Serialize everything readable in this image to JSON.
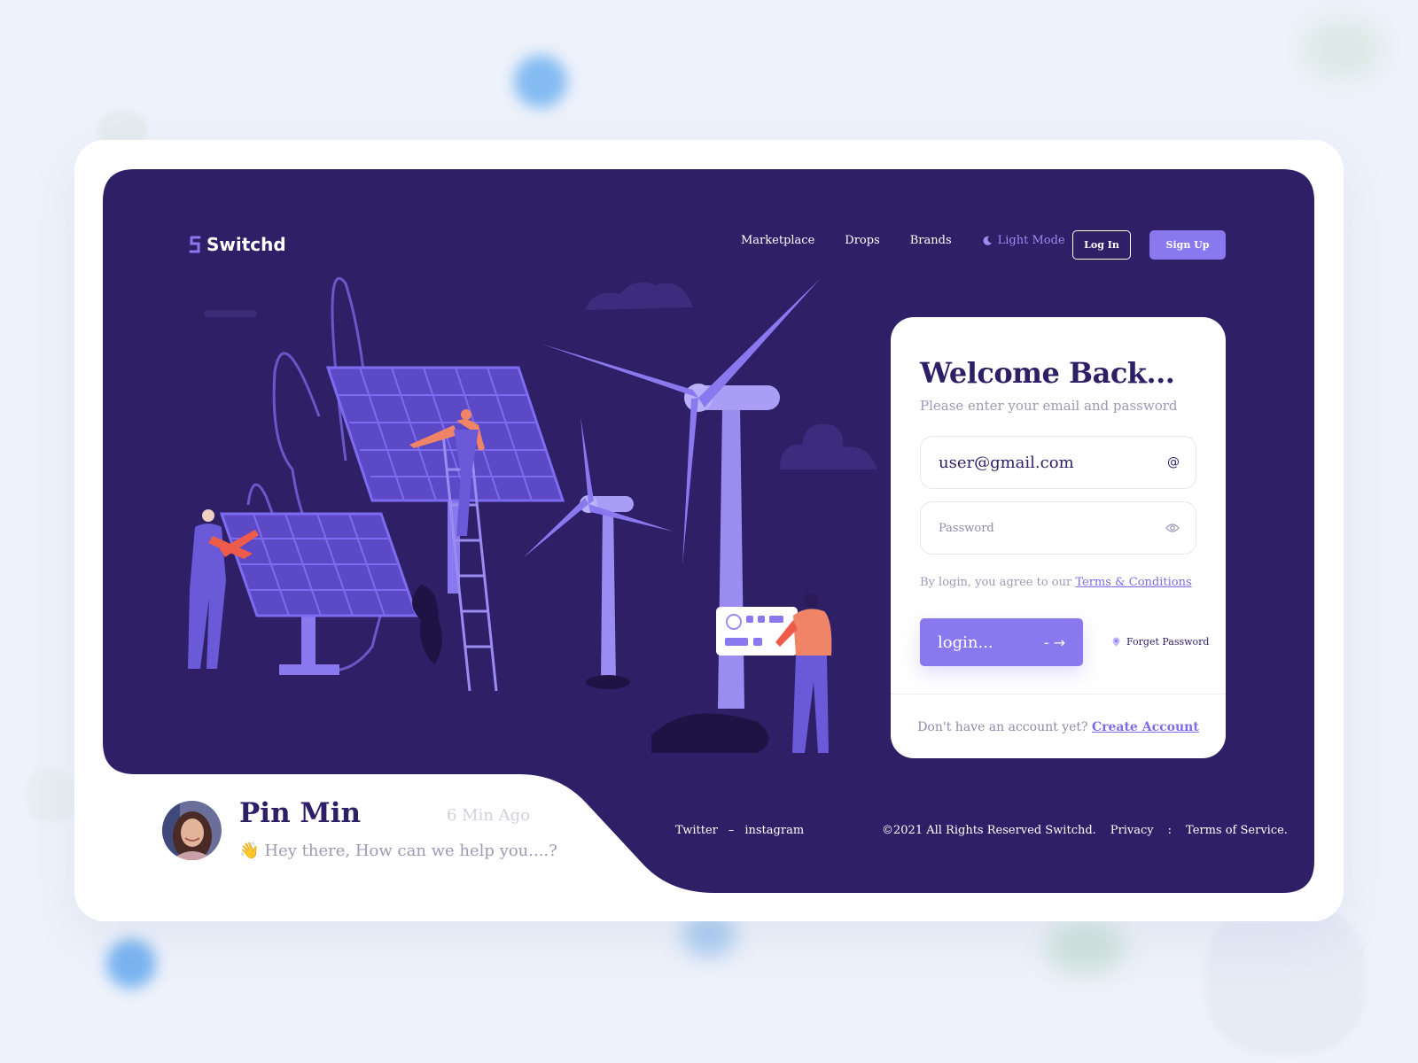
{
  "brand": {
    "name": "Switchd"
  },
  "nav": {
    "links": [
      "Marketplace",
      "Drops",
      "Brands"
    ],
    "mode_label": "Light Mode",
    "login_label": "Log In",
    "signup_label": "Sign Up"
  },
  "login_card": {
    "title": "Welcome Back...",
    "subtitle": "Please enter your email and password",
    "email_value": "user@gmail.com",
    "password_placeholder": "Password",
    "agree_text": "By login, you agree to our",
    "terms_link": "Terms & Conditions",
    "submit_label": "login...",
    "submit_arrow": "- →",
    "forget_label": "Forget Password",
    "no_account_text": "Don't have an account yet?",
    "create_account_link": "Create Account"
  },
  "chat": {
    "name": "Pin Min",
    "time": "6 Min Ago",
    "emoji": "👋",
    "message": "Hey there, How can we help you....?"
  },
  "footer": {
    "social": [
      "Twitter",
      "–",
      "instagram"
    ],
    "copyright": "©2021 All Rights Reserved Switchd.",
    "privacy": "Privacy",
    "sep": ":",
    "terms": "Terms of Service."
  },
  "colors": {
    "hero_bg": "#2e1f66",
    "accent": "#8a78ee",
    "title": "#2d1f66"
  }
}
